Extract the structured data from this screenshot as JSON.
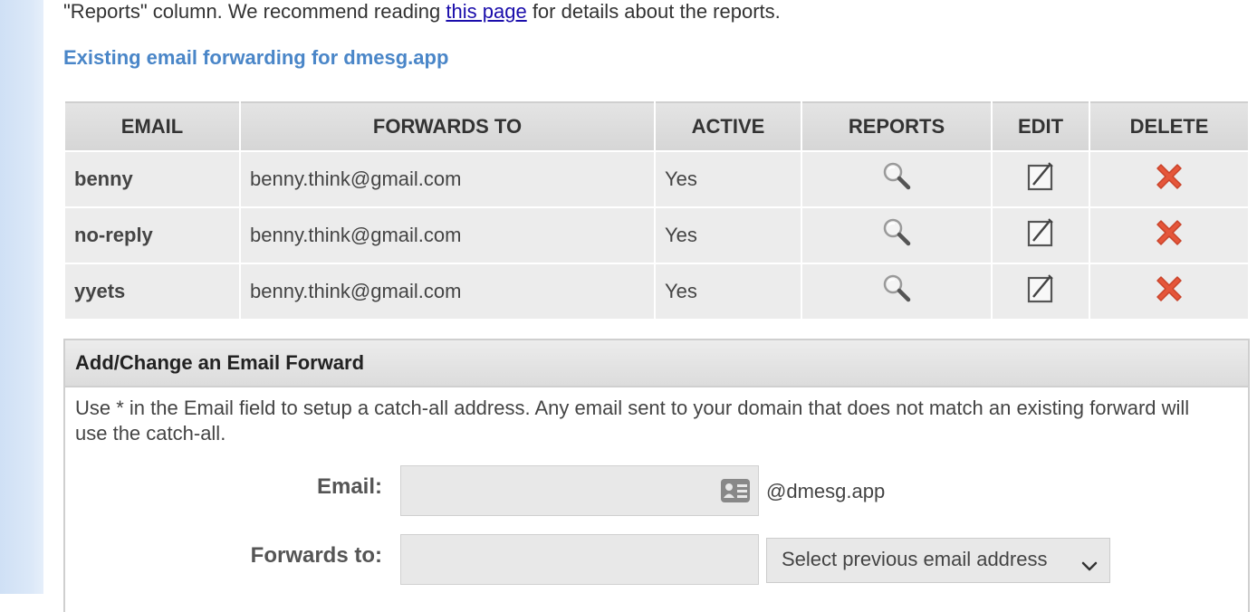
{
  "intro": {
    "text_before": "\"Reports\" column. We recommend reading ",
    "link": "this page",
    "text_after": " for details about the reports."
  },
  "section_title": "Existing email forwarding for dmesg.app",
  "table": {
    "headers": [
      "EMAIL",
      "FORWARDS TO",
      "ACTIVE",
      "REPORTS",
      "EDIT",
      "DELETE"
    ],
    "rows": [
      {
        "email": "benny",
        "forwards_to": "benny.think@gmail.com",
        "active": "Yes"
      },
      {
        "email": "no-reply",
        "forwards_to": "benny.think@gmail.com",
        "active": "Yes"
      },
      {
        "email": "yyets",
        "forwards_to": "benny.think@gmail.com",
        "active": "Yes"
      }
    ],
    "icons": {
      "reports": "magnifier-icon",
      "edit": "edit-icon",
      "delete": "delete-x-icon"
    }
  },
  "form": {
    "title": "Add/Change an Email Forward",
    "note": "Use * in the Email field to setup a catch-all address. Any email sent to your domain that does not match an existing forward will use the catch-all.",
    "email_label": "Email:",
    "email_value": "",
    "domain_suffix": "@dmesg.app",
    "forwards_label": "Forwards to:",
    "forwards_value": "",
    "select_placeholder": "Select previous email address"
  },
  "colors": {
    "heading": "#4a86c8",
    "delete": "#e5563a",
    "side_strip": "#d6e5f7"
  }
}
